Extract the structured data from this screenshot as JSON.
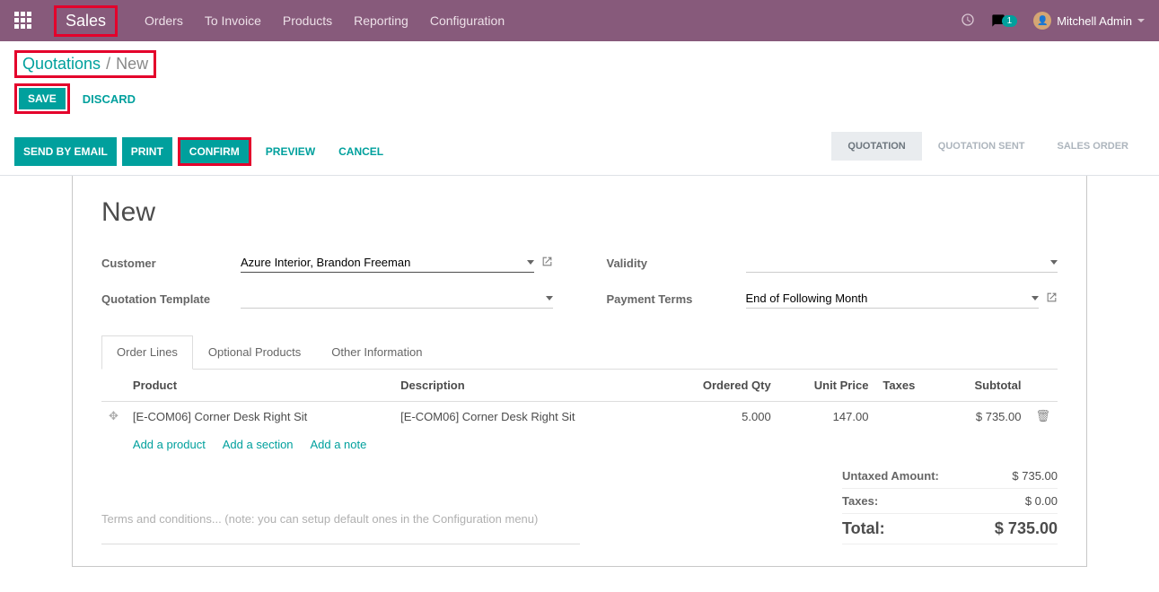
{
  "header": {
    "brand": "Sales",
    "menu": [
      "Orders",
      "To Invoice",
      "Products",
      "Reporting",
      "Configuration"
    ],
    "chat_count": "1",
    "user_name": "Mitchell Admin"
  },
  "breadcrumb": {
    "root": "Quotations",
    "sep": "/",
    "current": "New"
  },
  "actions": {
    "save": "SAVE",
    "discard": "DISCARD"
  },
  "buttons": {
    "send_email": "SEND BY EMAIL",
    "print": "PRINT",
    "confirm": "CONFIRM",
    "preview": "PREVIEW",
    "cancel": "CANCEL"
  },
  "statuses": [
    "QUOTATION",
    "QUOTATION SENT",
    "SALES ORDER"
  ],
  "title": "New",
  "fields": {
    "customer_label": "Customer",
    "customer_value": "Azure Interior, Brandon Freeman",
    "template_label": "Quotation Template",
    "template_value": "",
    "validity_label": "Validity",
    "validity_value": "",
    "terms_label": "Payment Terms",
    "terms_value": "End of Following Month"
  },
  "tabs": [
    "Order Lines",
    "Optional Products",
    "Other Information"
  ],
  "columns": {
    "product": "Product",
    "description": "Description",
    "qty": "Ordered Qty",
    "price": "Unit Price",
    "taxes": "Taxes",
    "subtotal": "Subtotal"
  },
  "lines": [
    {
      "product": "[E-COM06] Corner Desk Right Sit",
      "description": "[E-COM06] Corner Desk Right Sit",
      "qty": "5.000",
      "price": "147.00",
      "taxes": "",
      "subtotal": "$ 735.00"
    }
  ],
  "add_links": {
    "product": "Add a product",
    "section": "Add a section",
    "note": "Add a note"
  },
  "terms_placeholder": "Terms and conditions... (note: you can setup default ones in the Configuration menu)",
  "totals": {
    "untaxed_label": "Untaxed Amount:",
    "untaxed_value": "$ 735.00",
    "taxes_label": "Taxes:",
    "taxes_value": "$ 0.00",
    "total_label": "Total:",
    "total_value": "$ 735.00"
  }
}
